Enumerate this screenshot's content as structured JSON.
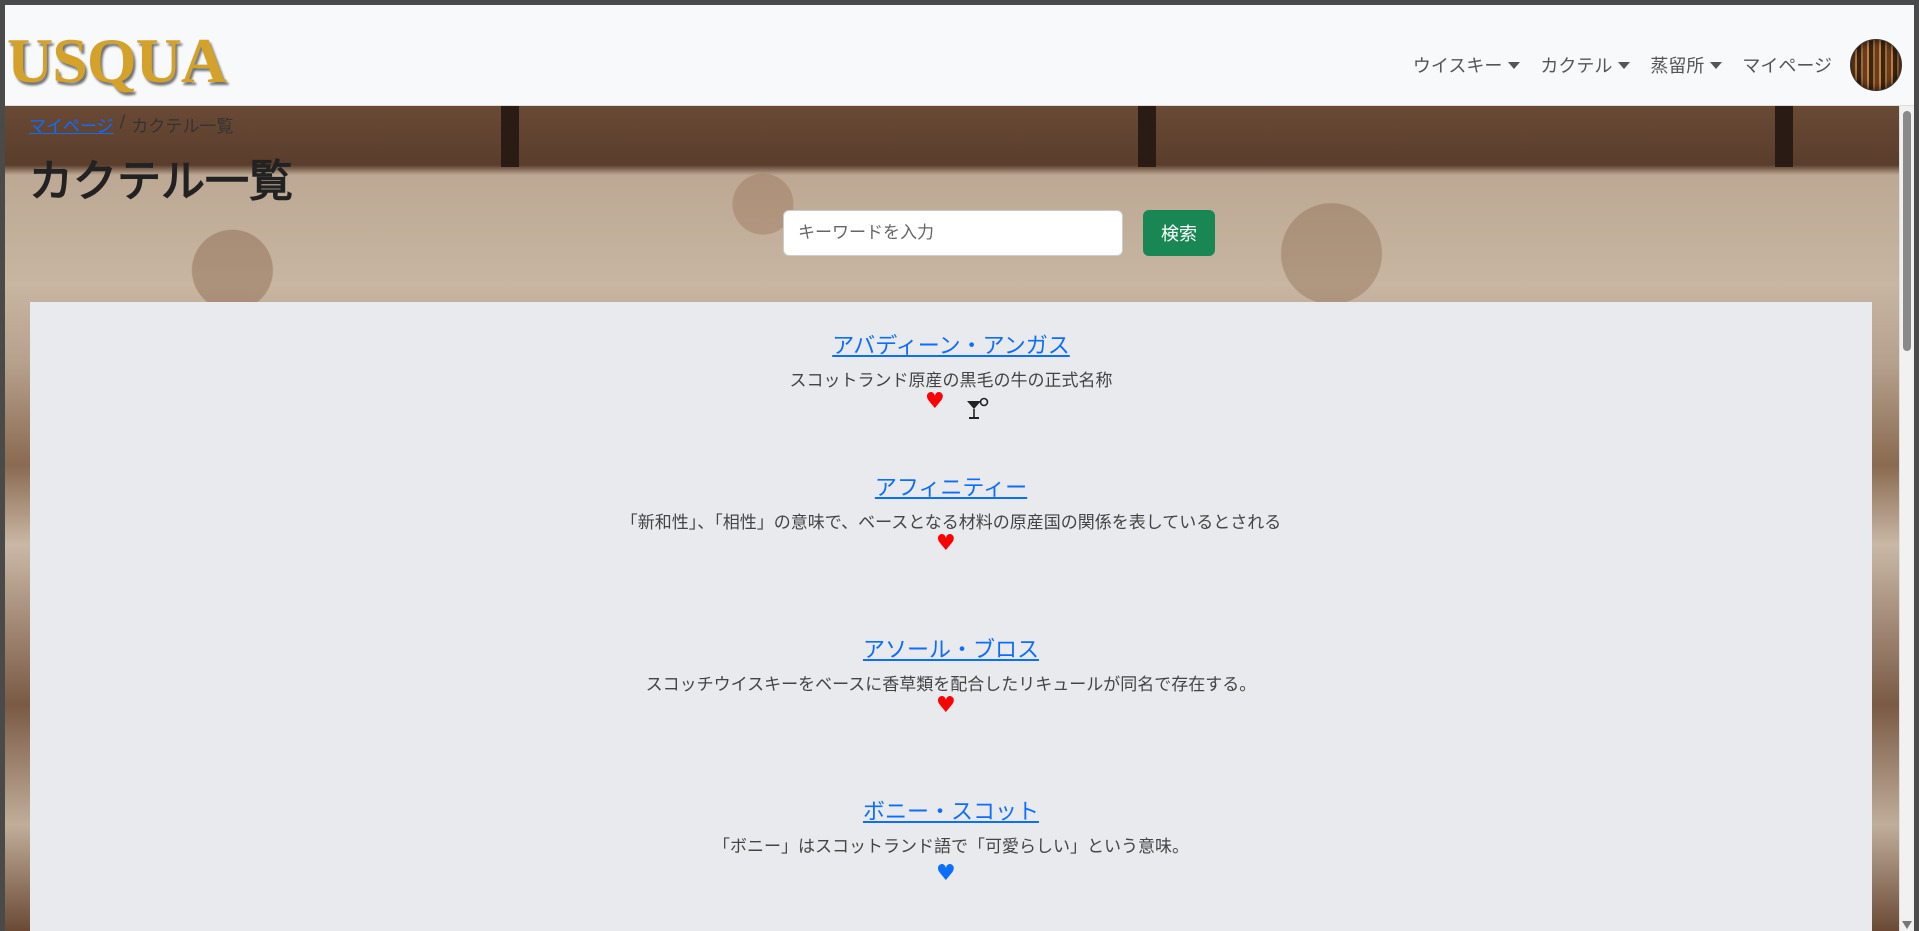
{
  "brand": "USQUA",
  "nav": {
    "items": [
      {
        "label": "ウイスキー",
        "dropdown": true
      },
      {
        "label": "カクテル",
        "dropdown": true
      },
      {
        "label": "蒸留所",
        "dropdown": true
      },
      {
        "label": "マイページ",
        "dropdown": false
      }
    ]
  },
  "breadcrumb": {
    "home": "マイページ",
    "separator": "/",
    "current": "カクテル一覧"
  },
  "page_title": "カクテル一覧",
  "search": {
    "placeholder": "キーワードを入力",
    "button": "検索"
  },
  "cocktails": [
    {
      "name": "アバディーン・アンガス",
      "description": "スコットランド原産の黒毛の牛の正式名称",
      "favorite_color": "red",
      "has_glass_icon": true
    },
    {
      "name": "アフィニティー",
      "description": "「新和性」、「相性」の意味で、ベースとなる材料の原産国の関係を表しているとされる",
      "favorite_color": "red",
      "has_glass_icon": false
    },
    {
      "name": "アソール・ブロス",
      "description": "スコッチウイスキーをベースに香草類を配合したリキュールが同名で存在する。",
      "favorite_color": "red",
      "has_glass_icon": false
    },
    {
      "name": "ボニー・スコット",
      "description": "「ボニー」はスコットランド語で「可愛らしい」という意味。",
      "favorite_color": "blue",
      "has_glass_icon": false
    }
  ],
  "colors": {
    "brand": "#d4a12a",
    "link": "#0d6efd",
    "search_button": "#198754",
    "heart_red": "#ff0000",
    "heart_blue": "#0d6efd"
  }
}
